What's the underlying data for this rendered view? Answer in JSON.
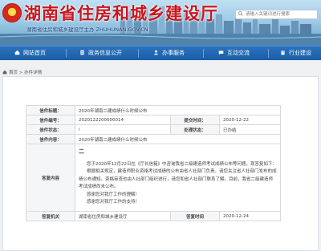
{
  "header": {
    "site_title": "湖南省住房和城乡建设厅",
    "site_subtitle": "湖南省住房和城乡建设厅主办 ZHUHUNAN.GOV.CN",
    "search_placeholder": "请输入关键词进行搜索",
    "search_icon": "search-icon",
    "emblem_icon": "national-emblem-icon"
  },
  "nav": {
    "items": [
      {
        "label": "网站首页",
        "icon": "home-icon"
      },
      {
        "label": "政务信息公开",
        "icon": "document-icon"
      },
      {
        "label": "办事服务",
        "icon": "service-icon"
      },
      {
        "label": "互动交流",
        "icon": "chat-icon"
      },
      {
        "label": "行业建设",
        "icon": "building-icon"
      }
    ]
  },
  "breadcrumb": {
    "home": "首页",
    "separator": ">",
    "current": "办件详情"
  },
  "detail": {
    "rows": [
      {
        "label": "信件标题：",
        "value": "2020年湖南二建成绩什么时候公布"
      },
      {
        "label": "信件编号：",
        "value": "2020122200000014",
        "label2": "提交时间：",
        "value2": "2020-12-22"
      },
      {
        "label": "信件状态：",
        "value": "i",
        "label2": "处理状态：",
        "value2": "已办结"
      },
      {
        "label": "信件内容：",
        "value": "2020年湖南二建成绩什么时候公布"
      }
    ],
    "reply": {
      "label": "答复内容",
      "glyph": "二",
      "paragraphs": [
        "您于2020年12月22日在《厅长信箱》中咨询我省二级建造师考试成绩公布等问题，现答复如下：",
        "根据相关规定，建造师职业资格考试成绩的公布由省人社部门负责。请您关注省人社部门发布的成绩公布通知。资格审查也由人社部门组织进行，请您和省人社部门联系了解。目前，我省二级建造师考试成绩尚未公布。",
        "感谢您对我厅工作的理解！",
        "感谢您对我厅工作的支持！"
      ]
    },
    "reply_dept": {
      "label": "答复机关",
      "value": "湖南省住房和城乡建设厅",
      "label2": "答复时间",
      "value2": "2020-12-24"
    }
  }
}
